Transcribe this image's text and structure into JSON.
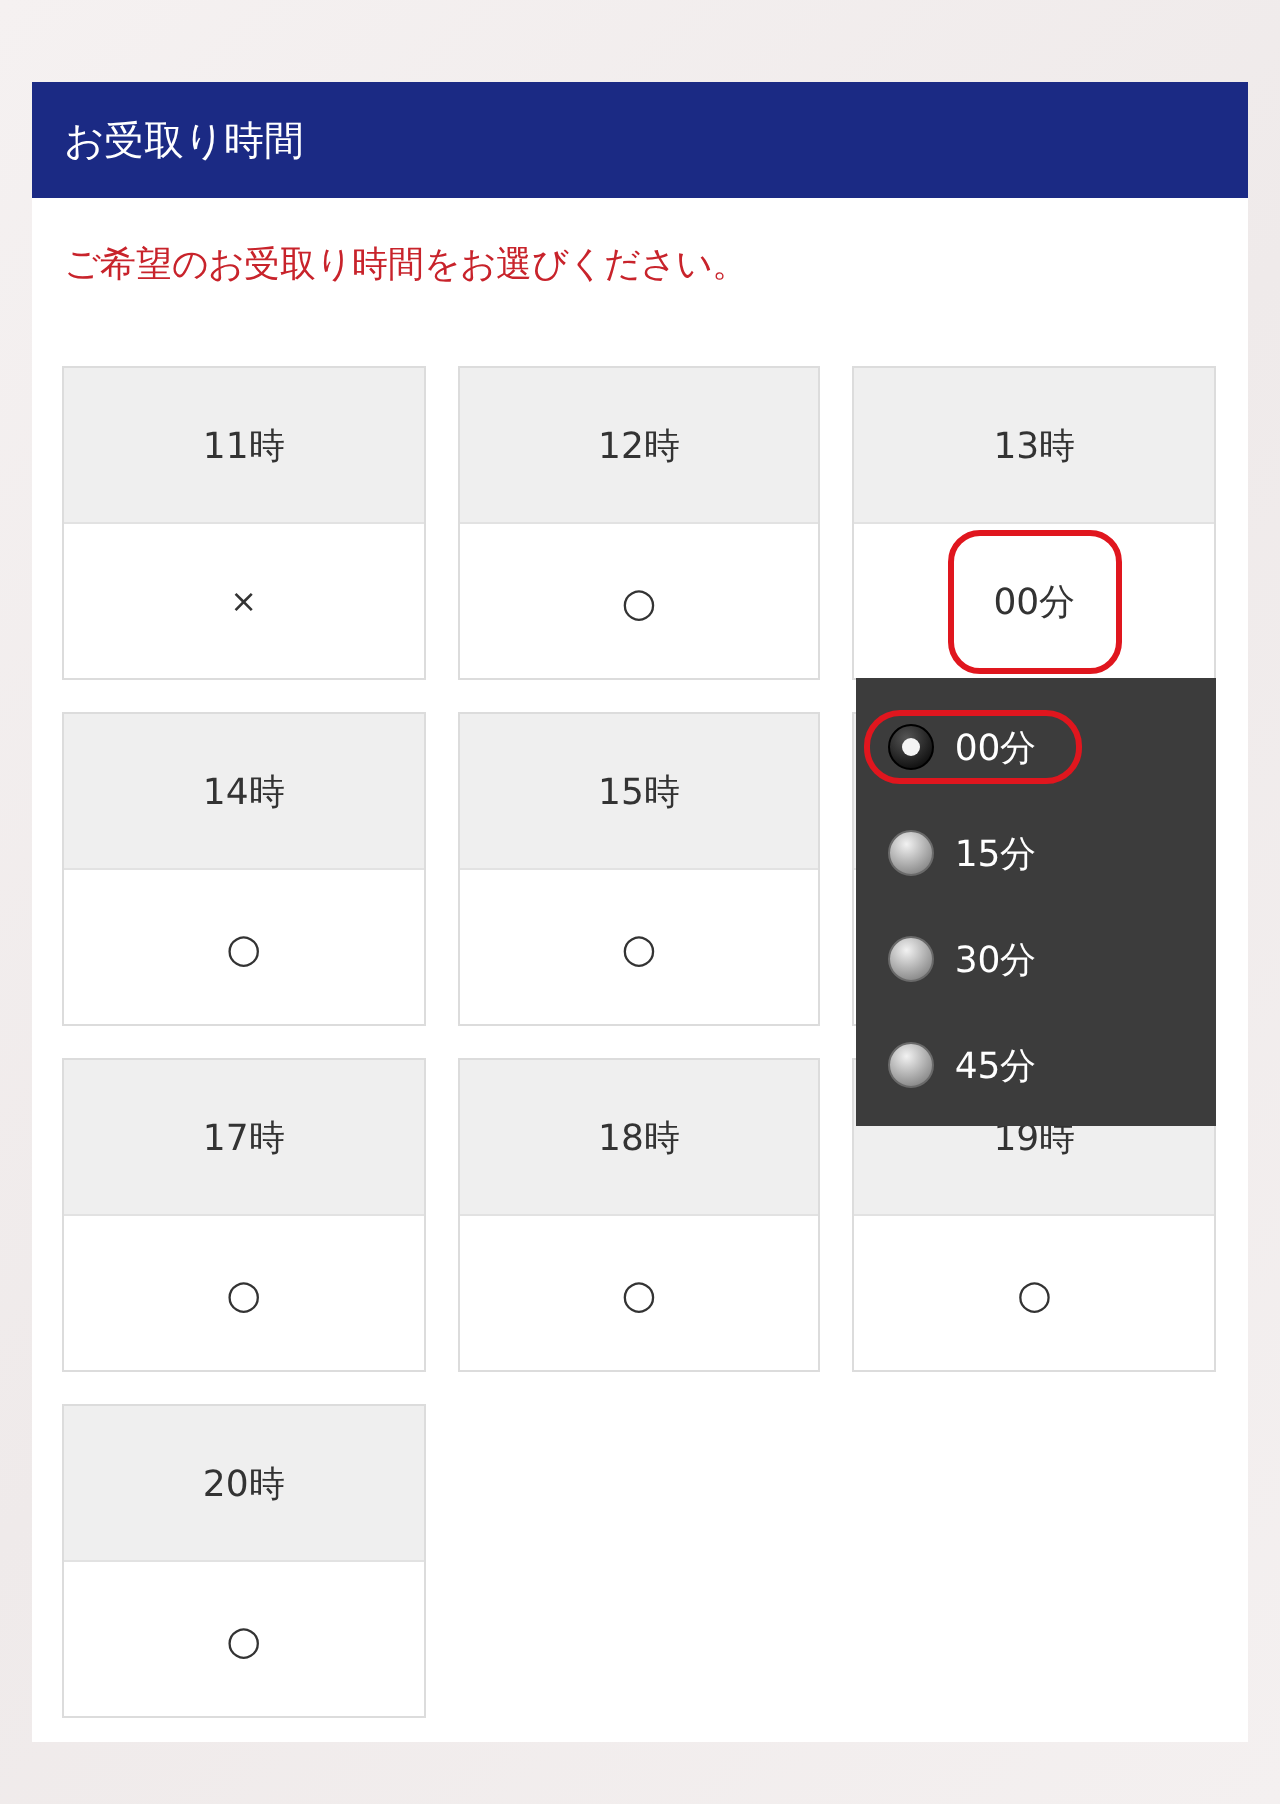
{
  "header": {
    "title": "お受取り時間"
  },
  "instruction": "ご希望のお受取り時間をお選びください。",
  "slots": [
    {
      "hour": "11時",
      "kind": "closed",
      "value": "×"
    },
    {
      "hour": "12時",
      "kind": "open",
      "value": "○"
    },
    {
      "hour": "13時",
      "kind": "select",
      "value": "00分",
      "highlighted": true,
      "expanded": true,
      "options": [
        {
          "label": "00分",
          "selected": true,
          "highlighted": true
        },
        {
          "label": "15分",
          "selected": false,
          "highlighted": false
        },
        {
          "label": "30分",
          "selected": false,
          "highlighted": false
        },
        {
          "label": "45分",
          "selected": false,
          "highlighted": false
        }
      ]
    },
    {
      "hour": "14時",
      "kind": "open",
      "value": "○"
    },
    {
      "hour": "15時",
      "kind": "open",
      "value": "○"
    },
    {
      "kind": "covered"
    },
    {
      "hour": "17時",
      "kind": "open",
      "value": "○"
    },
    {
      "hour": "18時",
      "kind": "open",
      "value": "○"
    },
    {
      "hour": "19時",
      "kind": "open",
      "value": "○"
    },
    {
      "hour": "20時",
      "kind": "open",
      "value": "○"
    }
  ]
}
